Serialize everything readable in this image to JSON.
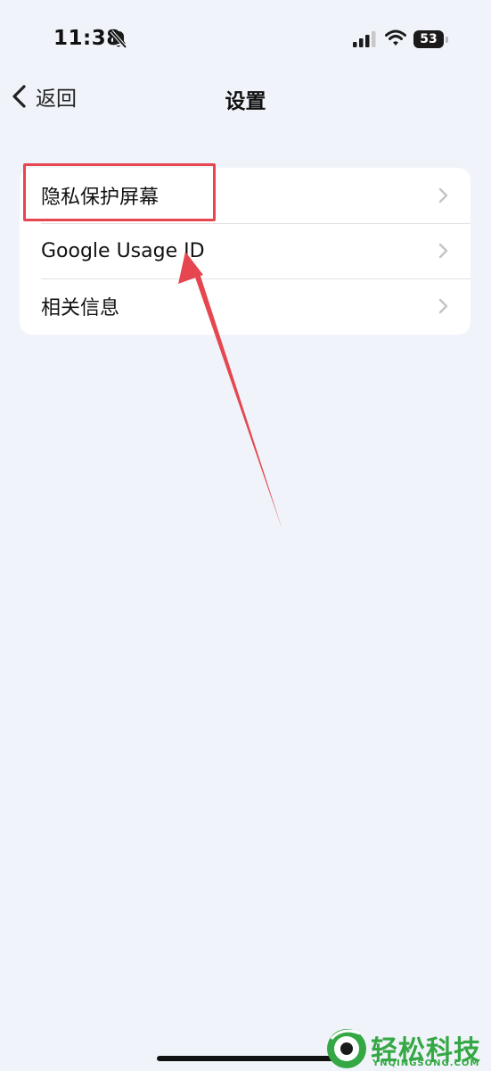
{
  "status_bar": {
    "time": "11:38",
    "bell_icon": "bell-slash-icon",
    "signal_icon": "cellular-signal-icon",
    "wifi_icon": "wifi-icon",
    "battery_level": "53"
  },
  "nav": {
    "back_icon": "chevron-left-icon",
    "back_label": "返回",
    "title": "设置"
  },
  "settings": {
    "items": [
      {
        "label": "隐私保护屏幕",
        "icon": "chevron-right-icon"
      },
      {
        "label": "Google Usage ID",
        "icon": "chevron-right-icon"
      },
      {
        "label": "相关信息",
        "icon": "chevron-right-icon"
      }
    ]
  },
  "annotation": {
    "color": "#e5464f",
    "highlighted_item": "隐私保护屏幕"
  },
  "watermark": {
    "text": "轻松科技",
    "sub": "YNQINGSONG.COM"
  },
  "colors": {
    "background": "#f0f4fa",
    "card": "#ffffff",
    "watermark": "#35a845"
  }
}
